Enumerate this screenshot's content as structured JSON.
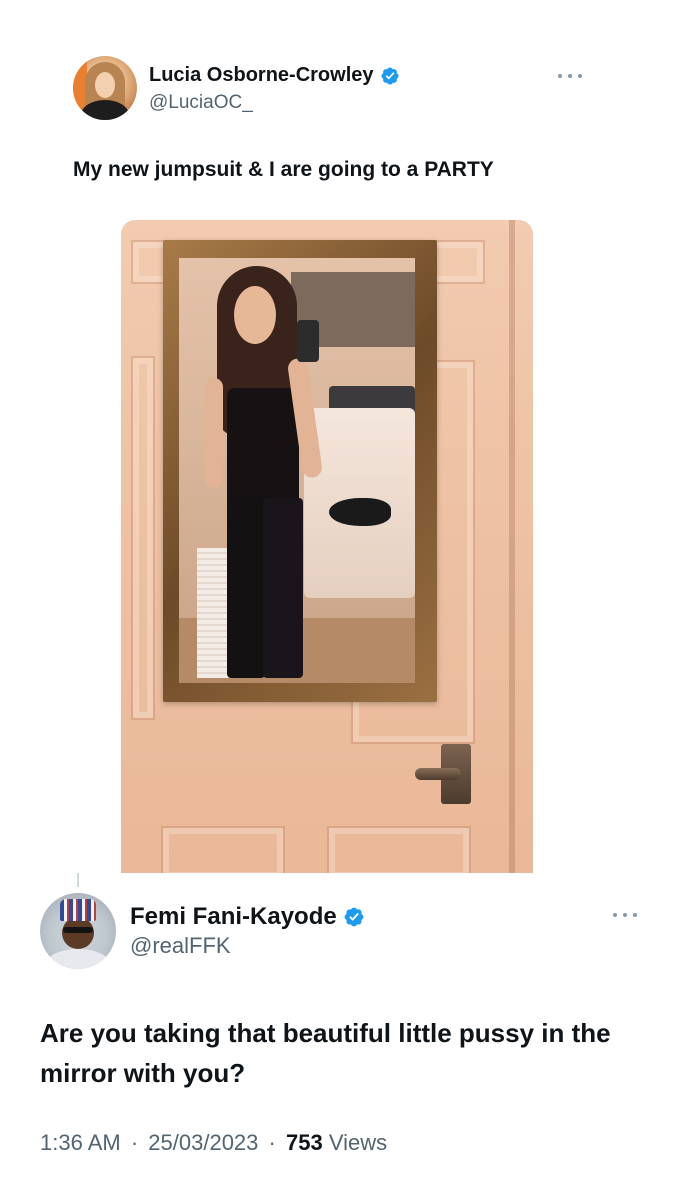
{
  "tweet1": {
    "author": {
      "display_name": "Lucia Osborne-Crowley",
      "handle": "@LuciaOC_",
      "verified_icon": "verified-badge-icon"
    },
    "text": "My new jumpsuit & I are going to a PARTY",
    "more_icon": "more-options-icon"
  },
  "tweet2": {
    "author": {
      "display_name": "Femi Fani-Kayode",
      "handle": "@realFFK",
      "verified_icon": "verified-badge-icon"
    },
    "text": "Are you taking that beautiful little pussy in the mirror with you?",
    "more_icon": "more-options-icon",
    "meta": {
      "time": "1:36 AM",
      "date": "25/03/2023",
      "separator": "·",
      "views_count": "753",
      "views_label": "Views"
    }
  },
  "colors": {
    "verified_blue": "#1d9bf0",
    "text_primary": "#0f1419",
    "text_secondary": "#536471"
  }
}
